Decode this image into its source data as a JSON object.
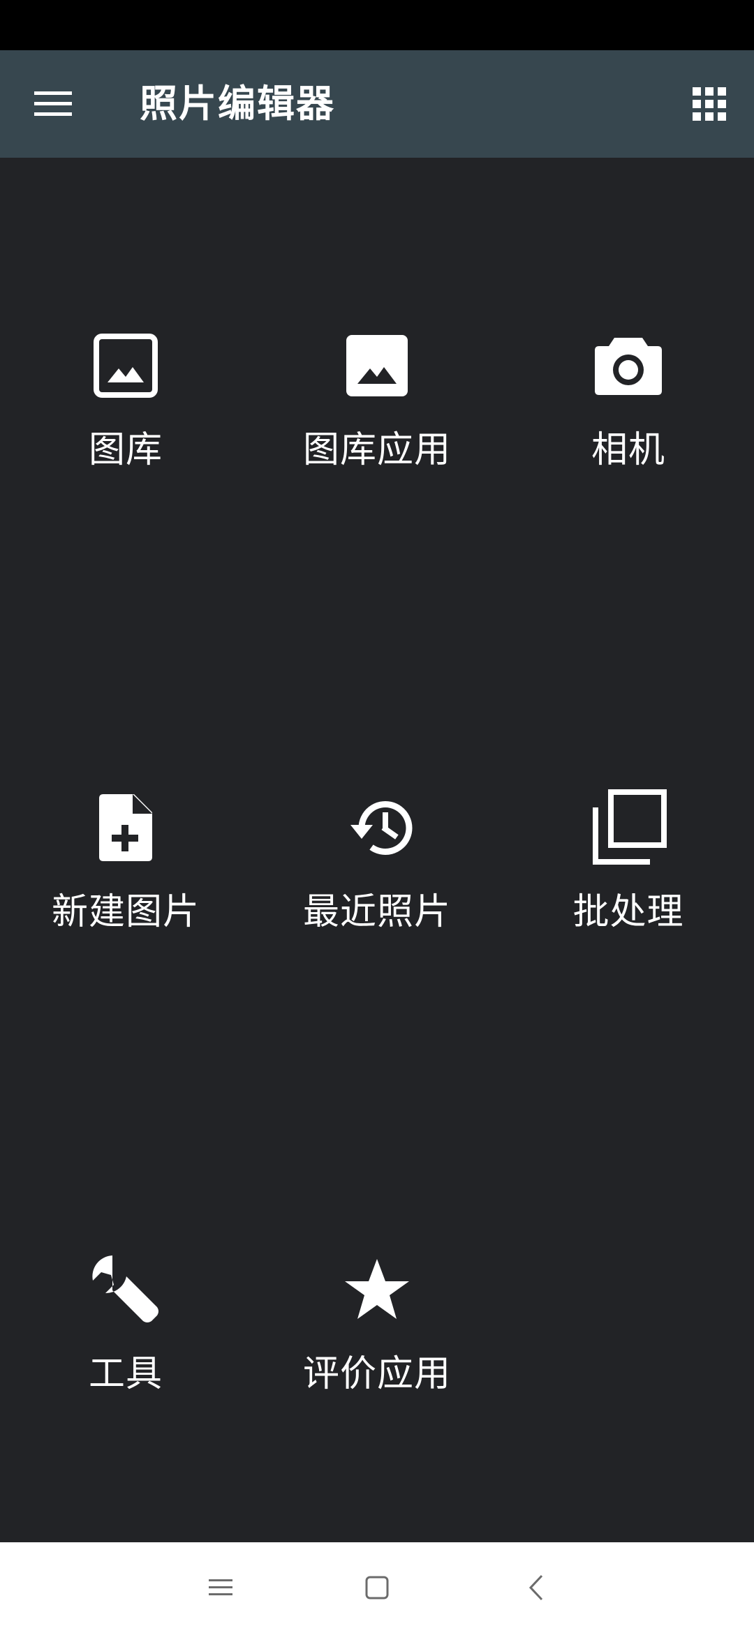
{
  "app_bar": {
    "title": "照片编辑器",
    "menu_icon": "hamburger-menu-icon",
    "apps_icon": "grid-apps-icon"
  },
  "menu": {
    "items": [
      {
        "label": "图库",
        "icon": "image-outline-icon"
      },
      {
        "label": "图库应用",
        "icon": "image-filled-icon"
      },
      {
        "label": "相机",
        "icon": "camera-icon"
      },
      {
        "label": "新建图片",
        "icon": "new-file-icon"
      },
      {
        "label": "最近照片",
        "icon": "history-icon"
      },
      {
        "label": "批处理",
        "icon": "filter-none-icon"
      },
      {
        "label": "工具",
        "icon": "wrench-icon"
      },
      {
        "label": "评价应用",
        "icon": "star-icon"
      }
    ]
  },
  "nav_bar": {
    "recents_icon": "recents-icon",
    "home_icon": "home-icon",
    "back_icon": "back-icon"
  },
  "colors": {
    "status_bar": "#000000",
    "app_bar": "#37474f",
    "background": "#222326",
    "nav_bar": "#ffffff",
    "icon": "#ffffff",
    "nav_icon": "#6b6b6b"
  }
}
